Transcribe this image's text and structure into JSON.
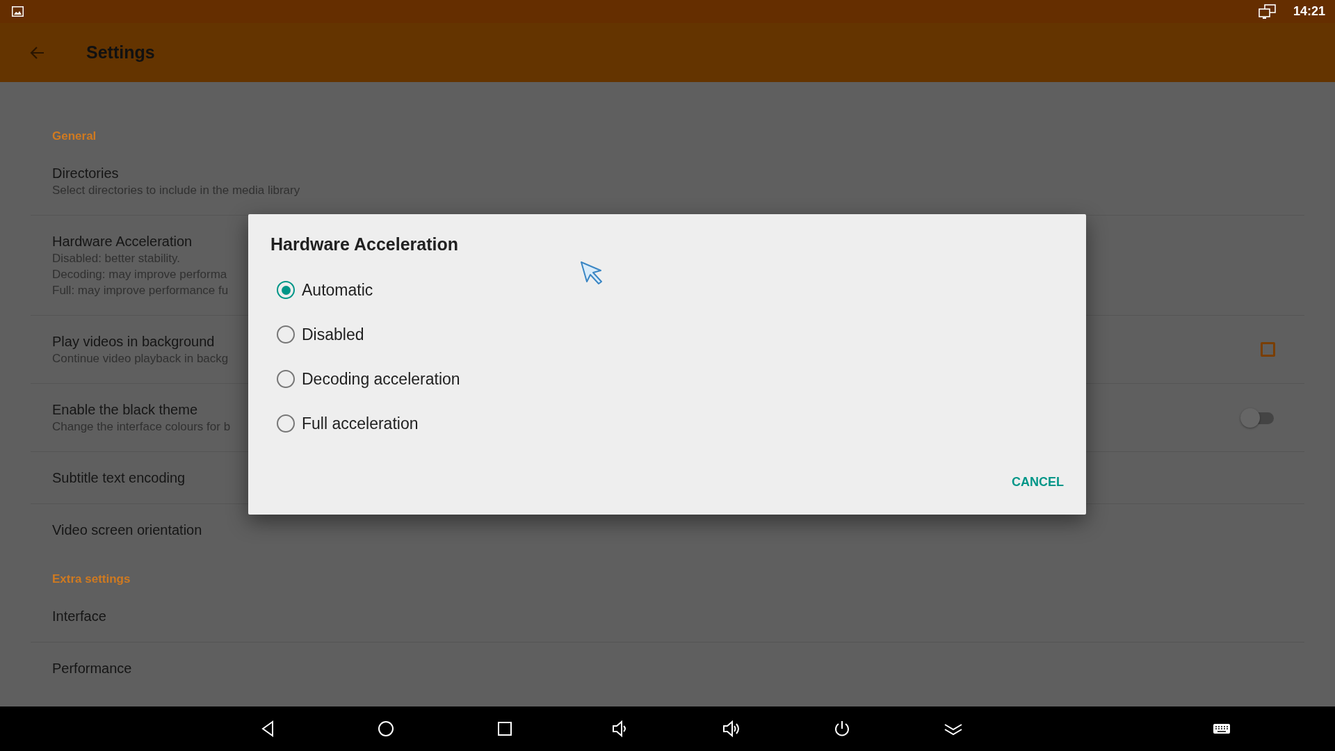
{
  "status_bar": {
    "time": "14:21"
  },
  "app_bar": {
    "title": "Settings"
  },
  "sections": [
    {
      "header": "General",
      "items": [
        {
          "kind": "plain",
          "title": "Directories",
          "subtitle": [
            "Select directories to include in the media library"
          ]
        },
        {
          "kind": "plain",
          "title": "Hardware Acceleration",
          "subtitle": [
            "Disabled: better stability.",
            "Decoding: may improve performa",
            "Full: may improve performance fu"
          ]
        },
        {
          "kind": "checkbox",
          "title": "Play videos in background",
          "subtitle": [
            "Continue video playback in backg"
          ],
          "checked": false
        },
        {
          "kind": "switch",
          "title": "Enable the black theme",
          "subtitle": [
            "Change the interface colours for b"
          ],
          "on": false
        },
        {
          "kind": "plain",
          "title": "Subtitle text encoding"
        },
        {
          "kind": "plain",
          "title": "Video screen orientation"
        }
      ]
    },
    {
      "header": "Extra settings",
      "items": [
        {
          "kind": "plain",
          "title": "Interface"
        },
        {
          "kind": "plain",
          "title": "Performance"
        }
      ]
    }
  ],
  "dialog": {
    "title": "Hardware Acceleration",
    "options": [
      {
        "label": "Automatic",
        "selected": true
      },
      {
        "label": "Disabled",
        "selected": false
      },
      {
        "label": "Decoding acceleration",
        "selected": false
      },
      {
        "label": "Full acceleration",
        "selected": false
      }
    ],
    "buttons": [
      "CANCEL"
    ]
  }
}
